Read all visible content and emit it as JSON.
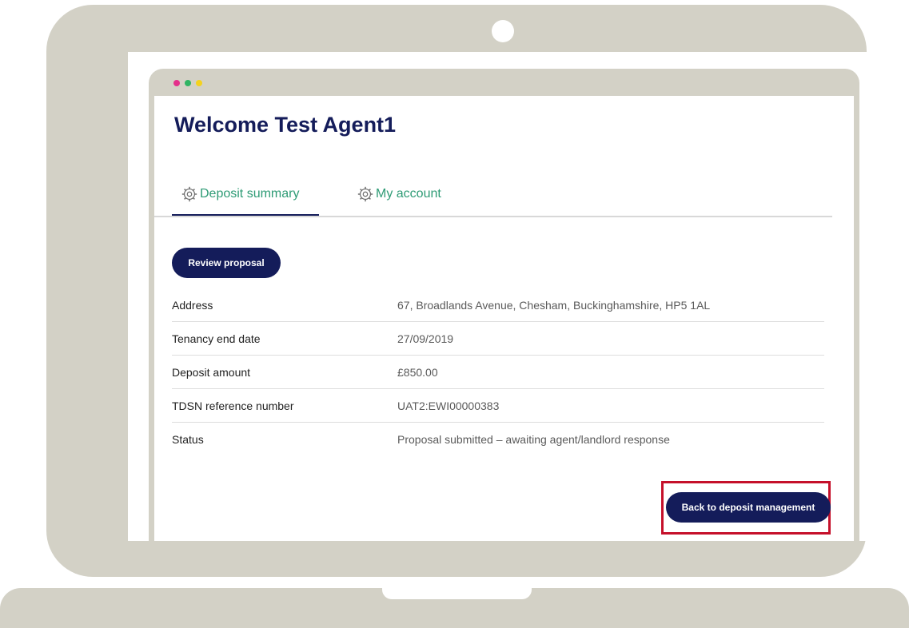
{
  "colors": {
    "frame": "#d3d1c6",
    "brand_navy": "#141c5a",
    "tab_green": "#2e9b75",
    "highlight_red": "#c5102a",
    "dot_pink": "#e4308b",
    "dot_green": "#2fb463",
    "dot_yellow": "#f4d21e"
  },
  "page": {
    "title": "Welcome Test Agent1"
  },
  "tabs": [
    {
      "label": "Deposit summary",
      "icon": "gear-icon",
      "active": true
    },
    {
      "label": "My account",
      "icon": "gear-icon",
      "active": false
    }
  ],
  "actions": {
    "review_label": "Review proposal",
    "back_label": "Back to deposit management"
  },
  "details": [
    {
      "label": "Address",
      "value": "67, Broadlands Avenue, Chesham, Buckinghamshire, HP5 1AL"
    },
    {
      "label": "Tenancy end date",
      "value": "27/09/2019"
    },
    {
      "label": "Deposit amount",
      "value": "£850.00"
    },
    {
      "label": "TDSN reference number",
      "value": "UAT2:EWI00000383"
    },
    {
      "label": "Status",
      "value": "Proposal submitted – awaiting agent/landlord response"
    }
  ]
}
